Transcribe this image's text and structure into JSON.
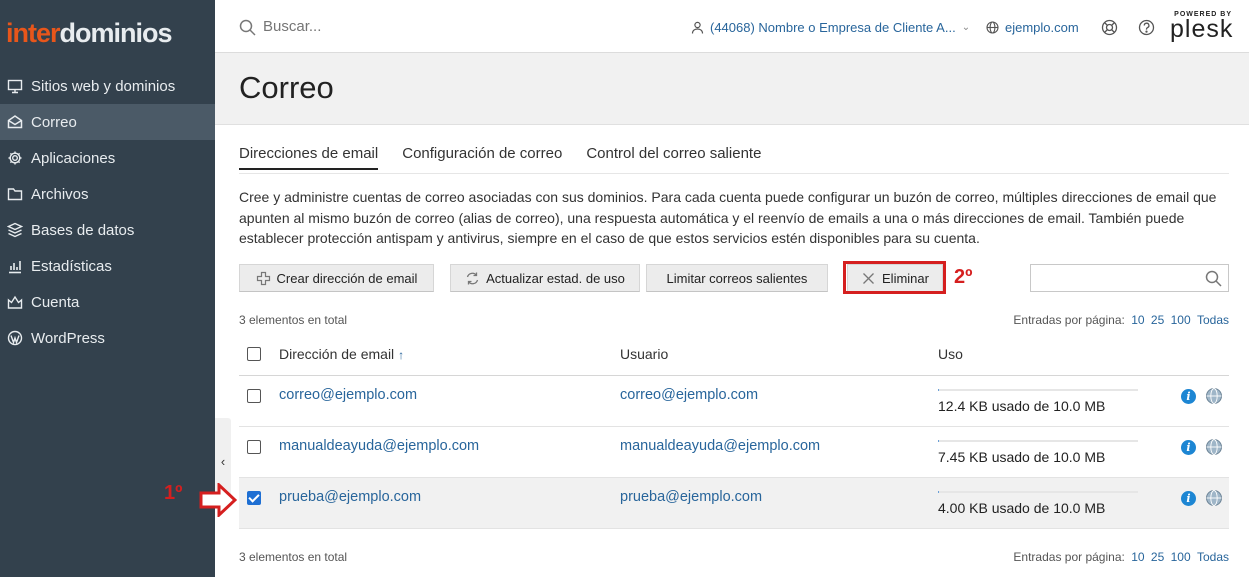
{
  "brand": {
    "logo_part1": "inter",
    "logo_part2": "dominios",
    "accent": "#e8561b"
  },
  "sidebar": {
    "items": [
      {
        "label": "Sitios web y dominios",
        "icon": "monitor-icon"
      },
      {
        "label": "Correo",
        "icon": "envelope-icon",
        "active": true
      },
      {
        "label": "Aplicaciones",
        "icon": "gear-icon"
      },
      {
        "label": "Archivos",
        "icon": "folder-icon"
      },
      {
        "label": "Bases de datos",
        "icon": "database-icon"
      },
      {
        "label": "Estadísticas",
        "icon": "bar-chart-icon"
      },
      {
        "label": "Cuenta",
        "icon": "account-icon"
      },
      {
        "label": "WordPress",
        "icon": "wordpress-icon"
      }
    ],
    "collapse_glyph": "‹"
  },
  "topbar": {
    "search_placeholder": "Buscar...",
    "client": "(44068) Nombre o Empresa de Cliente A...",
    "domain": "ejemplo.com",
    "powered_by": "POWERED BY",
    "plesk": "plesk"
  },
  "page": {
    "title": "Correo"
  },
  "tabs": [
    {
      "label": "Direcciones de email",
      "active": true
    },
    {
      "label": "Configuración de correo"
    },
    {
      "label": "Control del correo saliente"
    }
  ],
  "description": "Cree y administre cuentas de correo asociadas con sus dominios. Para cada cuenta puede configurar un buzón de correo, múltiples direcciones de email que apunten al mismo buzón de correo (alias de correo), una respuesta automática y el reenvío de emails a una o más direcciones de email. También puede establecer protección antispam y antivirus, siempre en el caso de que estos servicios estén disponibles para su cuenta.",
  "toolbar": {
    "create": "Crear dirección de email",
    "update_stats": "Actualizar estad. de uso",
    "limit": "Limitar correos salientes",
    "delete": "Eliminar"
  },
  "annotations": {
    "step1": "1º",
    "step2": "2º",
    "highlight_color": "#d51f1f"
  },
  "list": {
    "total": "3 elementos en total",
    "per_page_label": "Entradas por página:",
    "per_page_options": [
      "10",
      "25",
      "100",
      "Todas"
    ],
    "columns": {
      "email": "Dirección de email",
      "sort_indicator": "↑",
      "user": "Usuario",
      "usage": "Uso"
    },
    "rows": [
      {
        "email": "correo@ejemplo.com",
        "user": "correo@ejemplo.com",
        "usage": "12.4 KB usado de 10.0 MB",
        "checked": false,
        "usage_fraction": 0.0012
      },
      {
        "email": "manualdeayuda@ejemplo.com",
        "user": "manualdeayuda@ejemplo.com",
        "usage": "7.45 KB usado de 10.0 MB",
        "checked": false,
        "usage_fraction": 0.0007
      },
      {
        "email": "prueba@ejemplo.com",
        "user": "prueba@ejemplo.com",
        "usage": "4.00 KB usado de 10.0 MB",
        "checked": true,
        "usage_fraction": 0.0004
      }
    ]
  }
}
